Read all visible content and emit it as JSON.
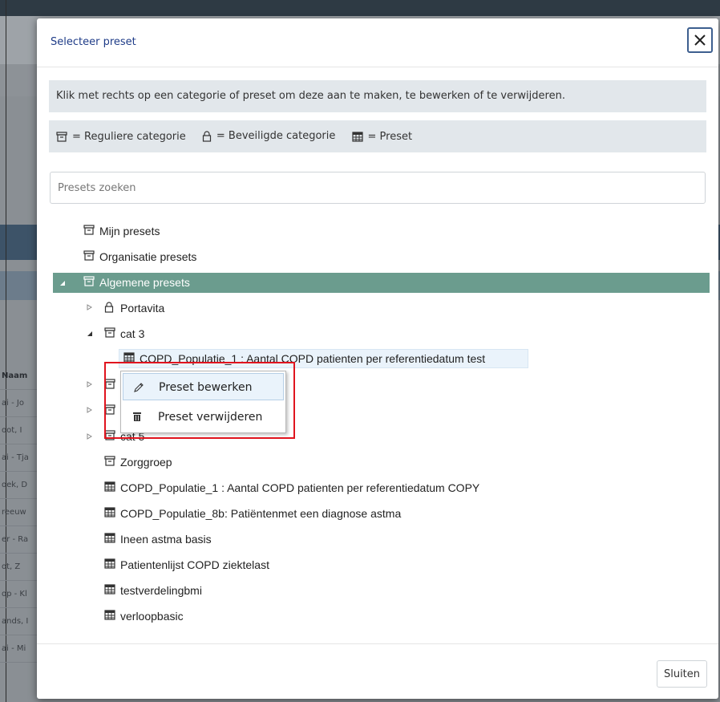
{
  "background": {
    "name_column_header": "Naam",
    "name_rows": [
      "ai - Jo",
      "oot, I",
      "ai - Tja",
      "oek, D",
      "reeuw",
      "er - Ra",
      "ot, Z",
      "op - Kl",
      "ands, I",
      "ai - Mi"
    ]
  },
  "modal": {
    "title": "Selecteer preset",
    "instruction": "Klik met rechts op een categorie of preset om deze aan te maken, te bewerken of te verwijderen.",
    "legend": {
      "regular": "= Reguliere categorie",
      "secured": "= Beveiligde categorie",
      "preset": "= Preset"
    },
    "search": {
      "placeholder": "Presets zoeken",
      "value": ""
    },
    "tree": {
      "mijn": "Mijn presets",
      "organisatie": "Organisatie presets",
      "algemene": "Algemene presets",
      "portavita": "Portavita",
      "cat3": "cat 3",
      "cat3_preset": "COPD_Populatie_1 : Aantal COPD patienten per referentiedatum test",
      "cat5": "cat 5",
      "zorggroep": "Zorggroep",
      "presets": [
        "COPD_Populatie_1 : Aantal COPD patienten per referentiedatum COPY",
        "COPD_Populatie_8b: Patiëntenmet een diagnose astma",
        "Ineen astma basis",
        "Patientenlijst COPD ziektelast",
        "testverdelingbmi",
        "verloopbasic"
      ]
    },
    "context_menu": {
      "edit": "Preset bewerken",
      "delete": "Preset verwijderen"
    },
    "footer": {
      "close": "Sluiten"
    }
  },
  "colors": {
    "selected_row": "#6b9c8e",
    "highlight": "#e0141e",
    "title": "#1f3c88"
  }
}
